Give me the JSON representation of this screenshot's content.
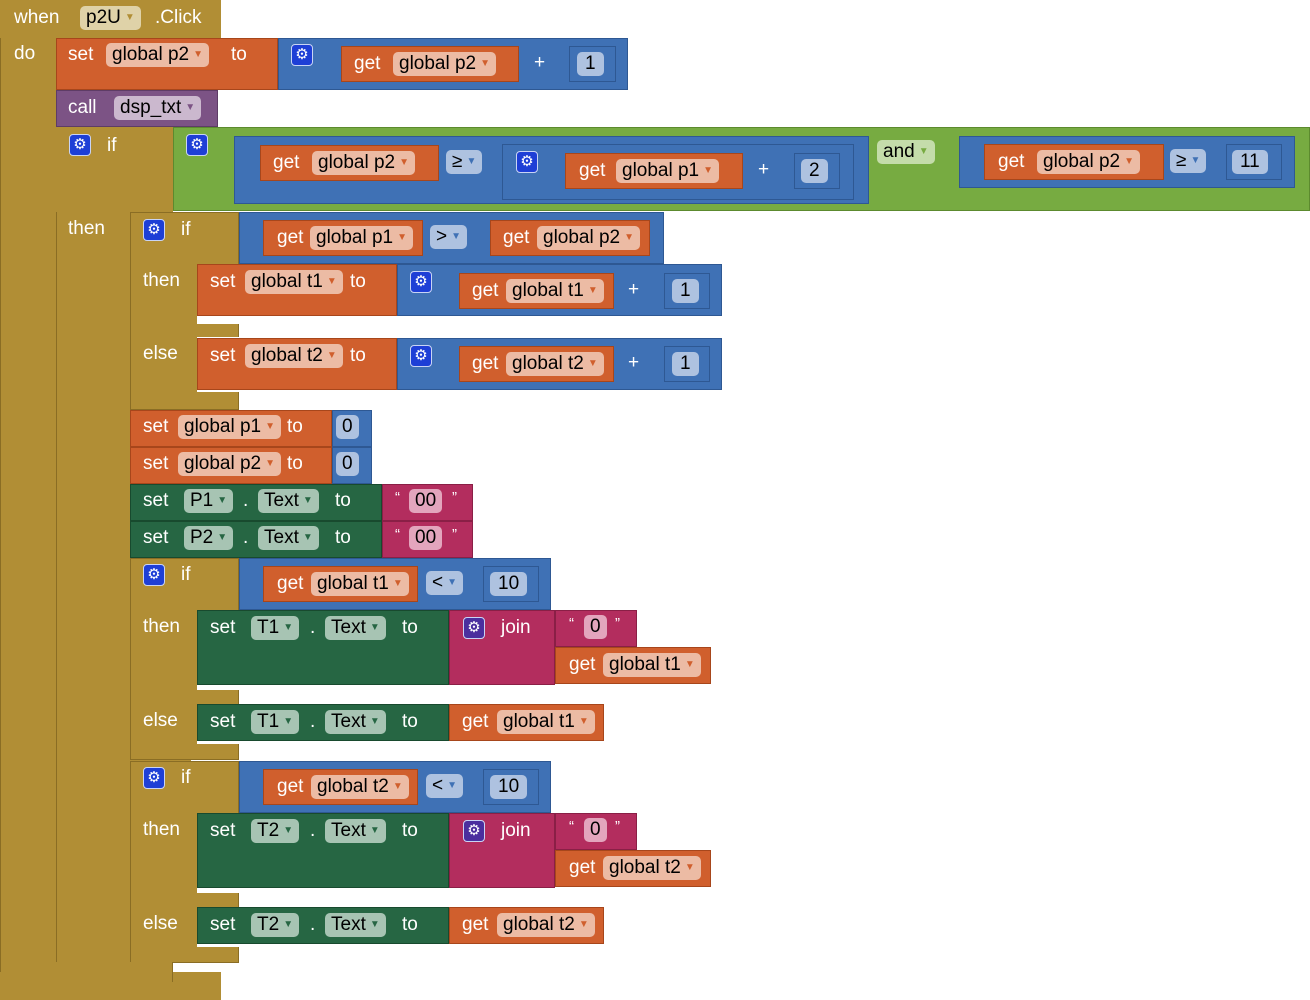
{
  "event": {
    "when": "when",
    "component": "p2U",
    "event": ".Click",
    "do": "do"
  },
  "words": {
    "set": "set",
    "get": "get",
    "to": "to",
    "call": "call",
    "if": "if",
    "then": "then",
    "else": "else",
    "and": "and",
    "plus": "+",
    "join": "join",
    "dot": ".",
    "open_quote": "“",
    "close_quote": "”"
  },
  "vars": {
    "p1": "global p1",
    "p2": "global p2",
    "t1": "global t1",
    "t2": "global t2"
  },
  "procedure": "dsp_txt",
  "operators": {
    "gte": "≥",
    "gt": ">",
    "lt": "<"
  },
  "numbers": {
    "one": "1",
    "two": "2",
    "eleven": "11",
    "ten": "10",
    "zero": "0"
  },
  "components": {
    "p1": "P1",
    "p2": "P2",
    "t1": "T1",
    "t2": "T2",
    "prop": "Text"
  },
  "strings": {
    "double_zero": "00",
    "zero": "0"
  },
  "icons": {
    "mutator": "gear-icon",
    "dropdown": "triangle-down-icon"
  },
  "colors": {
    "event": "#b18e35",
    "variable": "#d05f2d",
    "math": "#3f71b5",
    "logic": "#77ab41",
    "procedure": "#7c5385",
    "component": "#266643",
    "text": "#b32d5e"
  }
}
